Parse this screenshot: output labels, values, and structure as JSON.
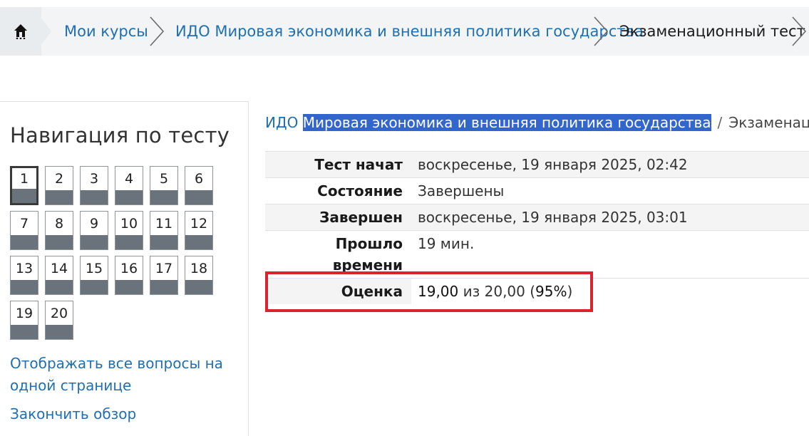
{
  "breadcrumb": {
    "home_icon": "home-icon",
    "items": [
      {
        "label": "Мои курсы"
      },
      {
        "label": "ИДО Мировая экономика и внешняя политика государства"
      },
      {
        "label": "Экзаменационный тест"
      }
    ]
  },
  "navigation": {
    "title": "Навигация по тесту",
    "questions": [
      "1",
      "2",
      "3",
      "4",
      "5",
      "6",
      "7",
      "8",
      "9",
      "10",
      "11",
      "12",
      "13",
      "14",
      "15",
      "16",
      "17",
      "18",
      "19",
      "20"
    ],
    "current_question": "1",
    "show_all_link": "Отображать все вопросы на одной странице",
    "finish_review_link": "Закончить обзор"
  },
  "heading": {
    "prefix": "ИДО ",
    "selected_text": "Мировая экономика и внешняя политика государства",
    "separator": "/",
    "tail": "Экзаменационный тест"
  },
  "summary": {
    "rows": [
      {
        "label": "Тест начат",
        "value": "воскресенье, 19 января 2025, 02:42"
      },
      {
        "label": "Состояние",
        "value": "Завершены"
      },
      {
        "label": "Завершен",
        "value": "воскресенье, 19 января 2025, 03:01"
      },
      {
        "label": "Прошло времени",
        "value": "19 мин."
      }
    ],
    "grade": {
      "label": "Оценка",
      "score": "19,00",
      "out_of_text": " из 20,00 (",
      "percent": "95%",
      "close_paren": ")"
    }
  },
  "colors": {
    "link": "#1f6fb2",
    "selection": "#3366cc",
    "highlight_box": "#d9232e",
    "question_bar": "#6a737b"
  }
}
